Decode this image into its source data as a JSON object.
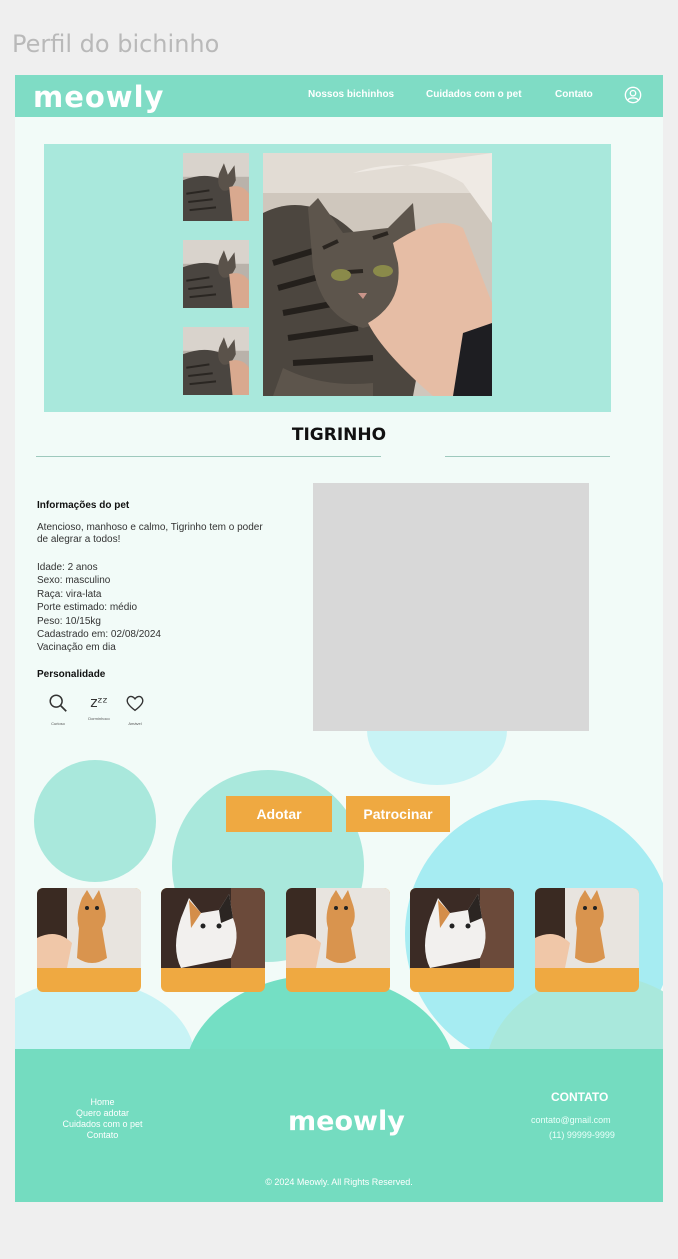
{
  "frame_title": "Perfil do bichinho",
  "header": {
    "logo": "meowly",
    "nav": [
      "Nossos bichinhos",
      "Cuidados com o pet",
      "Contato"
    ],
    "user_icon": "user-circle-icon"
  },
  "pet": {
    "name": "TIGRINHO",
    "info_title": "Informações do pet",
    "description": "Atencioso, manhoso e calmo, Tigrinho tem o poder de alegrar a todos!",
    "details": [
      "Idade: 2 anos",
      "Sexo: masculino",
      "Raça: vira-lata",
      "Porte estimado: médio",
      "Peso: 10/15kg",
      "Cadastrado em: 02/08/2024",
      "Vacinação em dia"
    ],
    "personality_title": "Personalidade",
    "traits": [
      {
        "icon": "search-icon",
        "label": "Curioso"
      },
      {
        "icon": "zzz-icon",
        "glyph": "zᶻᶻ",
        "label": "Dorminhoco"
      },
      {
        "icon": "heart-icon",
        "label": "Amável"
      }
    ]
  },
  "actions": {
    "adopt": "Adotar",
    "sponsor": "Patrocinar"
  },
  "footer": {
    "links": [
      "Home",
      "Quero adotar",
      "Cuidados com o pet",
      "Contato"
    ],
    "logo": "meowly",
    "contact_title": "CONTATO",
    "email": "contato@gmail.com",
    "phone": "(11) 99999-9999",
    "copyright": "© 2024 Meowly. All Rights Reserved."
  },
  "colors": {
    "brand_mint": "#7fdcc5",
    "panel_mint": "#a9e8dc",
    "button_orange": "#efa941",
    "placeholder_gray": "#d8d8d8"
  }
}
